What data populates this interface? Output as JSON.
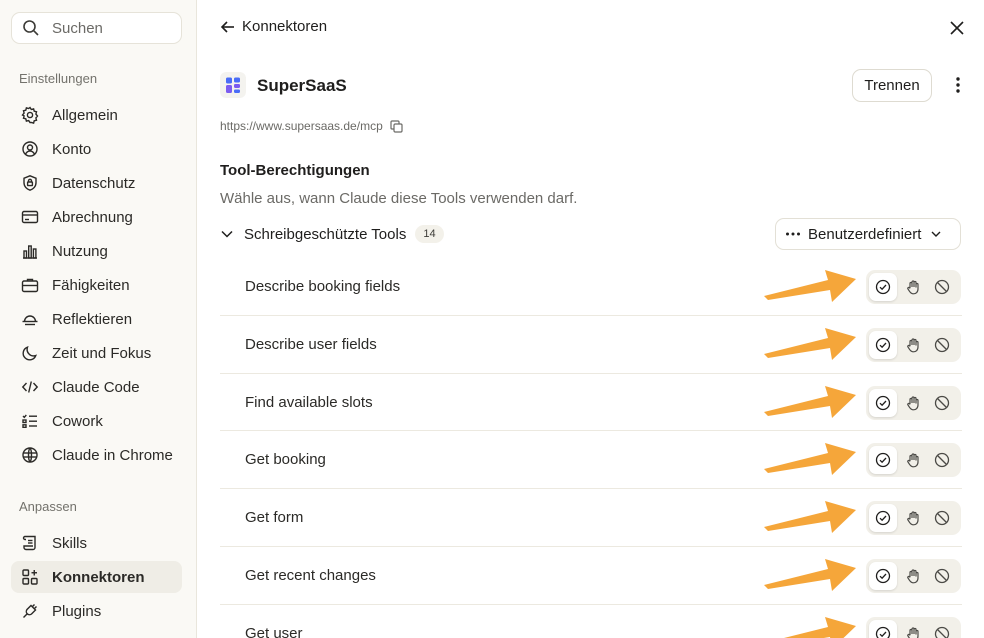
{
  "sidebar": {
    "search_placeholder": "Suchen",
    "section_settings": "Einstellungen",
    "section_customize": "Anpassen",
    "items": [
      {
        "label": "Allgemein",
        "icon": "gear-icon"
      },
      {
        "label": "Konto",
        "icon": "user-circle-icon"
      },
      {
        "label": "Datenschutz",
        "icon": "shield-icon"
      },
      {
        "label": "Abrechnung",
        "icon": "credit-card-icon"
      },
      {
        "label": "Nutzung",
        "icon": "bar-chart-icon"
      },
      {
        "label": "Fähigkeiten",
        "icon": "briefcase-icon"
      },
      {
        "label": "Reflektieren",
        "icon": "sunset-icon"
      },
      {
        "label": "Zeit und Fokus",
        "icon": "moon-icon"
      },
      {
        "label": "Claude Code",
        "icon": "code-icon"
      },
      {
        "label": "Cowork",
        "icon": "checklist-icon"
      },
      {
        "label": "Claude in Chrome",
        "icon": "globe-icon"
      }
    ],
    "customize_items": [
      {
        "label": "Skills",
        "icon": "scroll-icon"
      },
      {
        "label": "Konnektoren",
        "icon": "grid-plus-icon",
        "active": true
      },
      {
        "label": "Plugins",
        "icon": "plug-icon"
      }
    ]
  },
  "header": {
    "title": "Konnektoren"
  },
  "connector": {
    "name": "SuperSaaS",
    "disconnect_label": "Trennen",
    "url": "https://www.supersaas.de/mcp"
  },
  "permissions": {
    "title": "Tool-Berechtigungen",
    "description": "Wähle aus, wann Claude diese Tools verwenden darf.",
    "group_label": "Schreibgeschützte Tools",
    "group_count": "14",
    "mode_label": "Benutzerdefiniert",
    "tools": [
      {
        "label": "Describe booking fields",
        "selected": "allow"
      },
      {
        "label": "Describe user fields",
        "selected": "allow"
      },
      {
        "label": "Find available slots",
        "selected": "allow"
      },
      {
        "label": "Get booking",
        "selected": "allow"
      },
      {
        "label": "Get form",
        "selected": "allow"
      },
      {
        "label": "Get recent changes",
        "selected": "allow"
      },
      {
        "label": "Get user",
        "selected": "allow"
      }
    ]
  },
  "colors": {
    "annotation_arrow": "#f5a63a",
    "logo_blue": "#4a6cf7",
    "logo_purple": "#7b5cf0"
  }
}
